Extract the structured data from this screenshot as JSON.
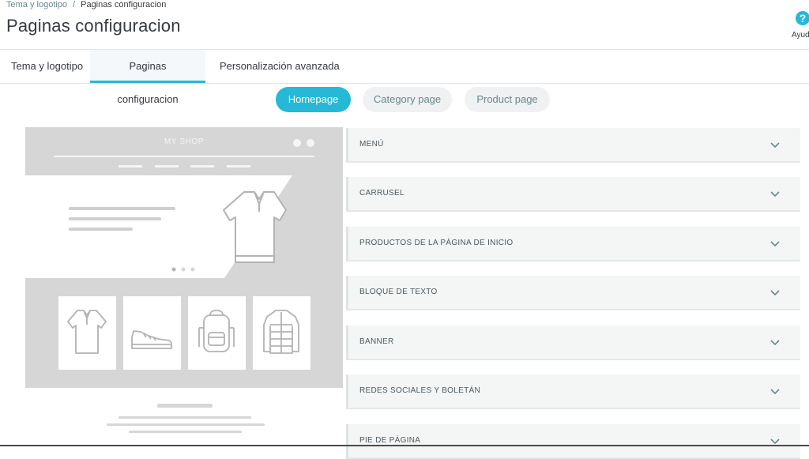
{
  "breadcrumb": {
    "parent": "Tema y logotipo",
    "separator": "/",
    "current": "Paginas configuracion"
  },
  "page_title": "Paginas configuracion",
  "help": {
    "icon": "question-icon",
    "glyph": "?",
    "label": "Ayud"
  },
  "tabs": [
    {
      "label": "Tema y logotipo",
      "active": false
    },
    {
      "label": "Paginas configuracion",
      "active": true
    },
    {
      "label": "Personalización avanzada",
      "active": false
    }
  ],
  "page_switch": [
    {
      "label": "Homepage",
      "active": true
    },
    {
      "label": "Category page",
      "active": false
    },
    {
      "label": "Product page",
      "active": false
    }
  ],
  "preview": {
    "shop_name": "MY SHOP",
    "product_icons": [
      "polo-shirt-icon",
      "sneaker-icon",
      "backpack-icon",
      "jacket-icon"
    ]
  },
  "sections": [
    {
      "label": "MENÚ"
    },
    {
      "label": "CARRUSEL"
    },
    {
      "label": "PRODUCTOS DE LA PÁGINA DE INICIO"
    },
    {
      "label": "BLOQUE DE TEXTO"
    },
    {
      "label": "BANNER"
    },
    {
      "label": "REDES SOCIALES Y BOLETÁN"
    },
    {
      "label": "PIE DE PÁGINA"
    }
  ],
  "colors": {
    "accent": "#25b9d7",
    "text": "#363a41",
    "muted": "#6c868e",
    "preview_gray": "#d6d6d6"
  }
}
